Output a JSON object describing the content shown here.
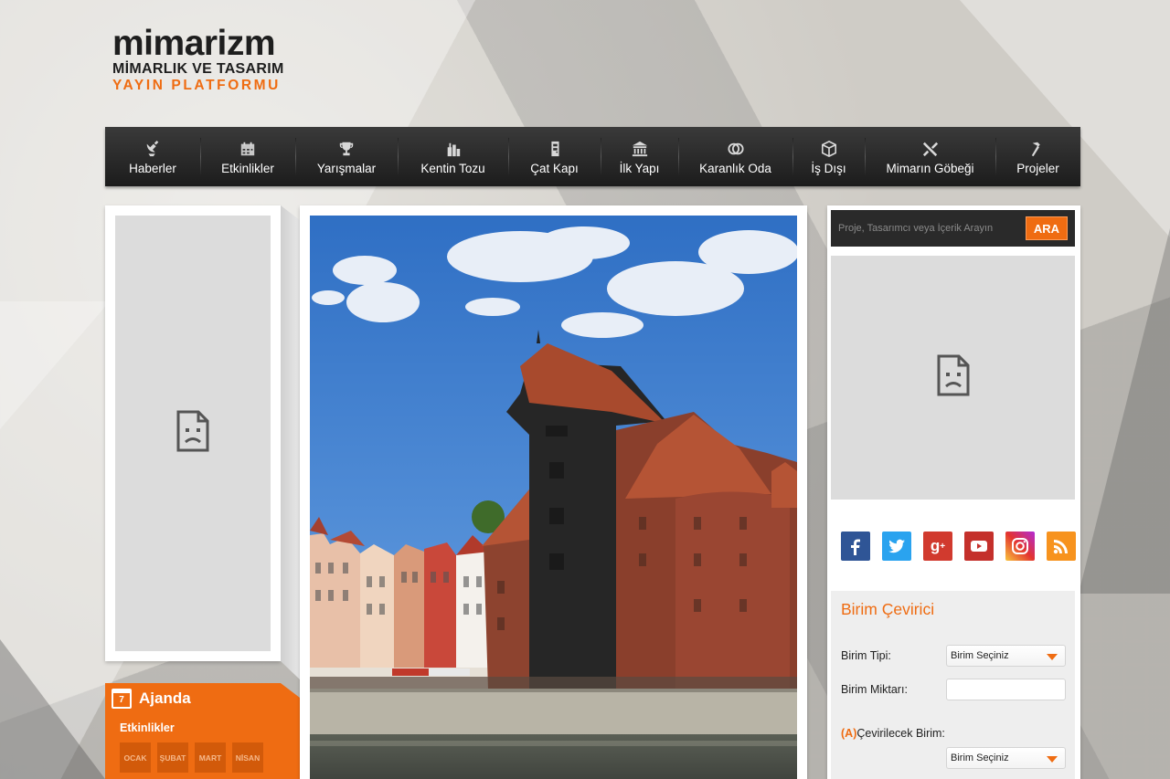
{
  "logo": {
    "main": "mimarizm",
    "line1": "MİMARLIK VE TASARIM",
    "line2": "YAYIN PLATFORMU"
  },
  "nav": {
    "items": [
      {
        "label": "Haberler",
        "icon": "satellite-dish-icon"
      },
      {
        "label": "Etkinlikler",
        "icon": "calendar-icon"
      },
      {
        "label": "Yarışmalar",
        "icon": "trophy-icon"
      },
      {
        "label": "Kentin Tozu",
        "icon": "city-buildings-icon"
      },
      {
        "label": "Çat Kapı",
        "icon": "door-icon"
      },
      {
        "label": "İlk Yapı",
        "icon": "classical-building-icon"
      },
      {
        "label": "Karanlık Oda",
        "icon": "lens-circles-icon"
      },
      {
        "label": "İş Dışı",
        "icon": "cube-icon"
      },
      {
        "label": "Mimarın Göbeği",
        "icon": "fork-knife-icon"
      },
      {
        "label": "Projeler",
        "icon": "hammer-icon"
      }
    ]
  },
  "ajanda": {
    "title": "Ajanda",
    "calendar_day": "7",
    "subtitle": "Etkinlikler",
    "months": [
      "OCAK",
      "ŞUBAT",
      "MART",
      "NİSAN"
    ]
  },
  "search": {
    "placeholder": "Proje, Tasarımcı veya İçerik Arayın",
    "button": "ARA"
  },
  "social": [
    "facebook-icon",
    "twitter-icon",
    "google-plus-icon",
    "youtube-icon",
    "instagram-icon",
    "rss-icon"
  ],
  "converter": {
    "title": "Birim Çevirici",
    "type_label": "Birim Tipi:",
    "type_value": "Birim Seçiniz",
    "amount_label": "Birim Miktarı:",
    "target_prefix": "(A)",
    "target_label": "Çevirilecek Birim:",
    "target_value": "Birim Seçiniz"
  },
  "colors": {
    "accent": "#ef6c12",
    "nav_bg": "#262626",
    "ad_placeholder": "#dcdcdc"
  }
}
